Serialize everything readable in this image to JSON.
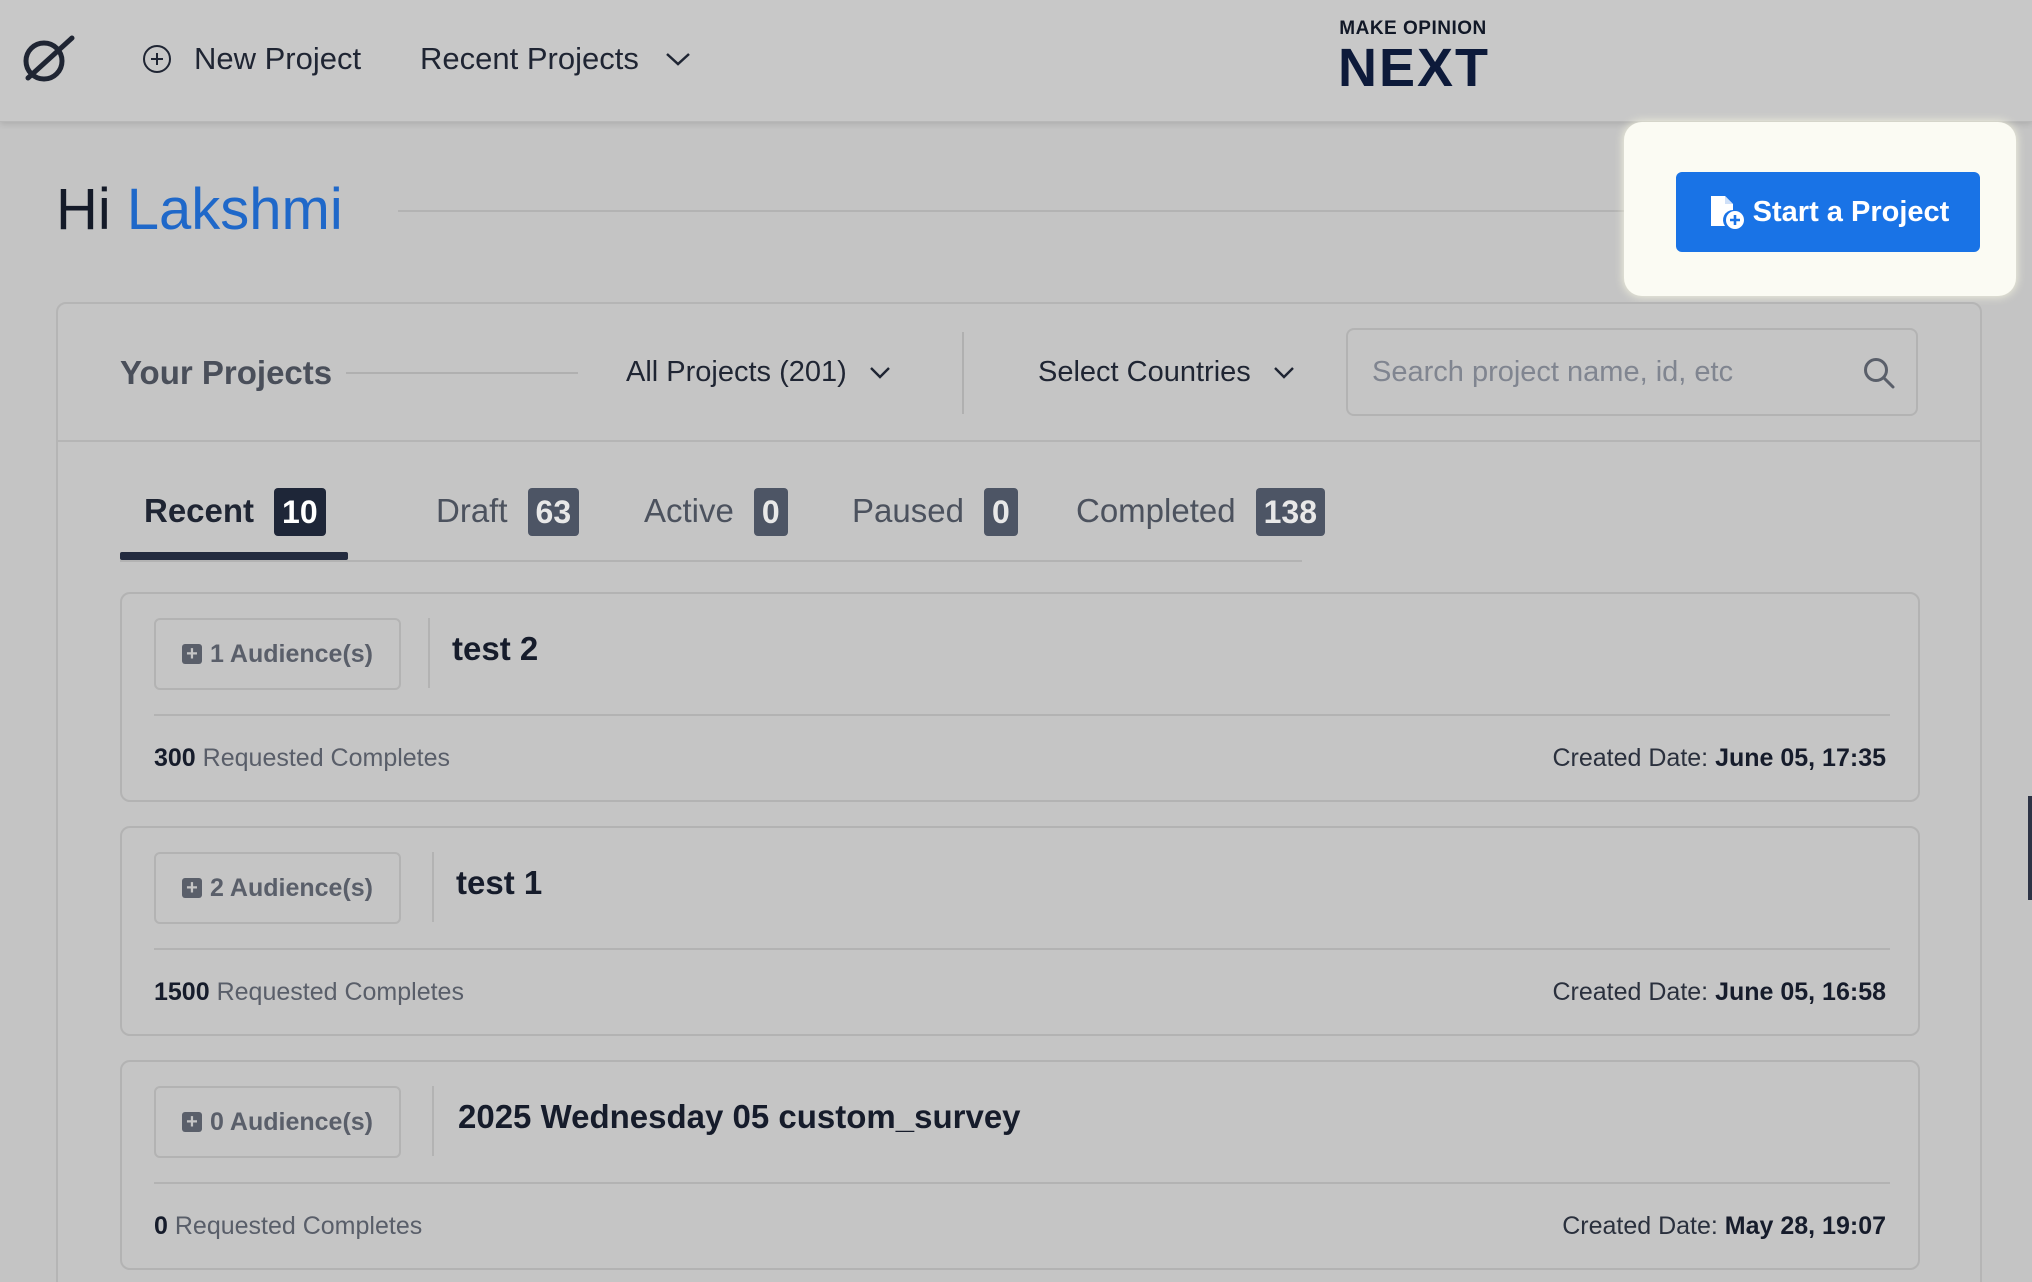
{
  "nav": {
    "new_project": "New Project",
    "recent_projects": "Recent Projects",
    "brand_top": "MAKE OPINION",
    "brand_main": "NEXT"
  },
  "greeting": {
    "hi": "Hi",
    "name": "Lakshmi"
  },
  "cta": {
    "label": "Start a Project"
  },
  "projects": {
    "heading": "Your Projects",
    "filter": "All Projects (201)",
    "countries": "Select Countries",
    "search_placeholder": "Search project name, id, etc"
  },
  "tabs": [
    {
      "label": "Recent",
      "count": "10",
      "active": true
    },
    {
      "label": "Draft",
      "count": "63",
      "active": false
    },
    {
      "label": "Active",
      "count": "0",
      "active": false
    },
    {
      "label": "Paused",
      "count": "0",
      "active": false
    },
    {
      "label": "Completed",
      "count": "138",
      "active": false
    }
  ],
  "cards": [
    {
      "audiences": "1 Audience(s)",
      "title": "test 2",
      "requested": "300",
      "requested_label": "Requested Completes",
      "created_label": "Created Date:",
      "created": "June 05, 17:35"
    },
    {
      "audiences": "2 Audience(s)",
      "title": "test 1",
      "requested": "1500",
      "requested_label": "Requested Completes",
      "created_label": "Created Date:",
      "created": "June 05, 16:58"
    },
    {
      "audiences": "0 Audience(s)",
      "title": "2025 Wednesday 05 custom_survey",
      "requested": "0",
      "requested_label": "Requested Completes",
      "created_label": "Created Date:",
      "created": "May 28, 19:07"
    }
  ],
  "colors": {
    "accent": "#1973e6",
    "name": "#1f68c9",
    "badge_active": "#1e2638"
  }
}
